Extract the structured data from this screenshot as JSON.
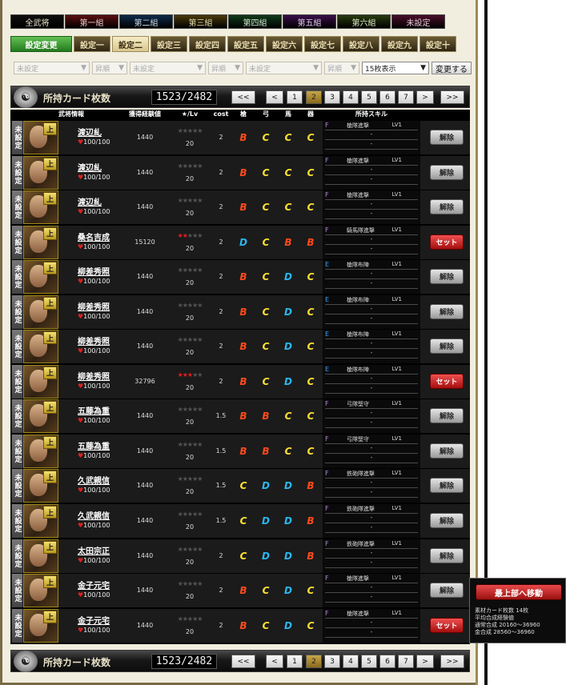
{
  "filter_tabs": [
    {
      "label": "全武将",
      "bg": "#0e0e0e",
      "fg": "#e8e2c8"
    },
    {
      "label": "第一組",
      "bg": "#5a1010",
      "fg": "#e8c8c8"
    },
    {
      "label": "第二組",
      "bg": "#0e2a4a",
      "fg": "#c8d8e8"
    },
    {
      "label": "第三組",
      "bg": "#4a3a0a",
      "fg": "#e8dcb0"
    },
    {
      "label": "第四組",
      "bg": "#0e3a1a",
      "fg": "#c8e8c8"
    },
    {
      "label": "第五組",
      "bg": "#3a0e4a",
      "fg": "#e0c8ec"
    },
    {
      "label": "第六組",
      "bg": "#2a3a10",
      "fg": "#d8e8c0"
    },
    {
      "label": "未設定",
      "bg": "#4a0e2a",
      "fg": "#e8c8d8"
    }
  ],
  "settings": {
    "change_label": "設定変更",
    "items": [
      "設定一",
      "設定二",
      "設定三",
      "設定四",
      "設定五",
      "設定六",
      "設定七",
      "設定八",
      "設定九",
      "設定十"
    ],
    "current": "設定二"
  },
  "filters": {
    "selects": [
      "未設定",
      "昇順",
      "未設定",
      "昇順",
      "未設定",
      "昇順"
    ],
    "per_page": "15枚表示",
    "change_button": "変更する"
  },
  "summary": {
    "label": "所持カード枚数",
    "count": "1523/2482"
  },
  "pager": [
    "<<",
    "<",
    "1",
    "2",
    "3",
    "4",
    "5",
    "6",
    "7",
    ">",
    ">>"
  ],
  "pager_current": "2",
  "headers": {
    "info": "武将情報",
    "exp": "獲得経験値",
    "star": "★/Lv",
    "cost": "cost",
    "a1": "槍",
    "a2": "弓",
    "a3": "馬",
    "a4": "器",
    "skill": "所持スキル"
  },
  "rows": [
    {
      "status": "未設定",
      "name": "渡辺糺",
      "hp": "100/100",
      "exp": "1440",
      "stars_red": "",
      "stars_grey": "★★★★★",
      "lv": "20",
      "cost": "2",
      "apt": [
        "B",
        "C",
        "C",
        "C"
      ],
      "rank": "F",
      "rank_color": "#b08ae0",
      "skill": "槍隊進撃",
      "skill_lv": "LV1",
      "action": "解除"
    },
    {
      "status": "未設定",
      "name": "渡辺糺",
      "hp": "100/100",
      "exp": "1440",
      "stars_red": "",
      "stars_grey": "★★★★★",
      "lv": "20",
      "cost": "2",
      "apt": [
        "B",
        "C",
        "C",
        "C"
      ],
      "rank": "F",
      "rank_color": "#b08ae0",
      "skill": "槍隊進撃",
      "skill_lv": "LV1",
      "action": "解除"
    },
    {
      "status": "未設定",
      "name": "渡辺糺",
      "hp": "100/100",
      "exp": "1440",
      "stars_red": "",
      "stars_grey": "★★★★★",
      "lv": "20",
      "cost": "2",
      "apt": [
        "B",
        "C",
        "C",
        "C"
      ],
      "rank": "F",
      "rank_color": "#b08ae0",
      "skill": "槍隊進撃",
      "skill_lv": "LV1",
      "action": "解除"
    },
    {
      "status": "未設定",
      "name": "桑名吉成",
      "hp": "100/100",
      "exp": "15120",
      "stars_red": "★★",
      "stars_grey": "★★★",
      "lv": "20",
      "cost": "2",
      "apt": [
        "D",
        "C",
        "B",
        "B"
      ],
      "rank": "F",
      "rank_color": "#b08ae0",
      "skill": "騎馬隊進撃",
      "skill_lv": "LV1",
      "action": "セット"
    },
    {
      "status": "未設定",
      "name": "柳差秀照",
      "hp": "100/100",
      "exp": "1440",
      "stars_red": "",
      "stars_grey": "★★★★★",
      "lv": "20",
      "cost": "2",
      "apt": [
        "B",
        "C",
        "D",
        "C"
      ],
      "rank": "E",
      "rank_color": "#3aa0ff",
      "skill": "槍隊布陣",
      "skill_lv": "LV1",
      "action": "解除"
    },
    {
      "status": "未設定",
      "name": "柳差秀照",
      "hp": "100/100",
      "exp": "1440",
      "stars_red": "",
      "stars_grey": "★★★★★",
      "lv": "20",
      "cost": "2",
      "apt": [
        "B",
        "C",
        "D",
        "C"
      ],
      "rank": "E",
      "rank_color": "#3aa0ff",
      "skill": "槍隊布陣",
      "skill_lv": "LV1",
      "action": "解除"
    },
    {
      "status": "未設定",
      "name": "柳差秀照",
      "hp": "100/100",
      "exp": "1440",
      "stars_red": "",
      "stars_grey": "★★★★★",
      "lv": "20",
      "cost": "2",
      "apt": [
        "B",
        "C",
        "D",
        "C"
      ],
      "rank": "E",
      "rank_color": "#3aa0ff",
      "skill": "槍隊布陣",
      "skill_lv": "LV1",
      "action": "解除"
    },
    {
      "status": "未設定",
      "name": "柳差秀照",
      "hp": "100/100",
      "exp": "32796",
      "stars_red": "★★★",
      "stars_grey": "★★",
      "lv": "20",
      "cost": "2",
      "apt": [
        "B",
        "C",
        "D",
        "C"
      ],
      "rank": "E",
      "rank_color": "#3aa0ff",
      "skill": "槍隊布陣",
      "skill_lv": "LV1",
      "action": "セット"
    },
    {
      "status": "未設定",
      "name": "五藤為重",
      "hp": "100/100",
      "exp": "1440",
      "stars_red": "",
      "stars_grey": "★★★★★",
      "lv": "20",
      "cost": "1.5",
      "apt": [
        "B",
        "B",
        "C",
        "C"
      ],
      "rank": "F",
      "rank_color": "#b08ae0",
      "skill": "弓隊堅守",
      "skill_lv": "LV1",
      "action": "解除"
    },
    {
      "status": "未設定",
      "name": "五藤為重",
      "hp": "100/100",
      "exp": "1440",
      "stars_red": "",
      "stars_grey": "★★★★★",
      "lv": "20",
      "cost": "1.5",
      "apt": [
        "B",
        "B",
        "C",
        "C"
      ],
      "rank": "F",
      "rank_color": "#b08ae0",
      "skill": "弓隊堅守",
      "skill_lv": "LV1",
      "action": "解除"
    },
    {
      "status": "未設定",
      "name": "久武親信",
      "hp": "100/100",
      "exp": "1440",
      "stars_red": "",
      "stars_grey": "★★★★★",
      "lv": "20",
      "cost": "1.5",
      "apt": [
        "C",
        "D",
        "D",
        "B"
      ],
      "rank": "F",
      "rank_color": "#b08ae0",
      "skill": "鉄砲隊進撃",
      "skill_lv": "LV1",
      "action": "解除"
    },
    {
      "status": "未設定",
      "name": "久武親信",
      "hp": "100/100",
      "exp": "1440",
      "stars_red": "",
      "stars_grey": "★★★★★",
      "lv": "20",
      "cost": "1.5",
      "apt": [
        "C",
        "D",
        "D",
        "B"
      ],
      "rank": "F",
      "rank_color": "#b08ae0",
      "skill": "鉄砲隊進撃",
      "skill_lv": "LV1",
      "action": "解除"
    },
    {
      "status": "未設定",
      "name": "太田宗正",
      "hp": "100/100",
      "exp": "1440",
      "stars_red": "",
      "stars_grey": "★★★★★",
      "lv": "20",
      "cost": "2",
      "apt": [
        "C",
        "D",
        "D",
        "B"
      ],
      "rank": "F",
      "rank_color": "#b08ae0",
      "skill": "鉄砲隊進撃",
      "skill_lv": "LV1",
      "action": "解除"
    },
    {
      "status": "未設定",
      "name": "金子元宅",
      "hp": "100/100",
      "exp": "1440",
      "stars_red": "",
      "stars_grey": "★★★★★",
      "lv": "20",
      "cost": "2",
      "apt": [
        "B",
        "C",
        "D",
        "C"
      ],
      "rank": "F",
      "rank_color": "#b08ae0",
      "skill": "槍隊進撃",
      "skill_lv": "LV1",
      "action": "解除"
    },
    {
      "status": "未設定",
      "name": "金子元宅",
      "hp": "100/100",
      "exp": "1440",
      "stars_red": "",
      "stars_grey": "★★★★★",
      "lv": "20",
      "cost": "2",
      "apt": [
        "B",
        "C",
        "D",
        "C"
      ],
      "rank": "F",
      "rank_color": "#b08ae0",
      "skill": "槍隊進撃",
      "skill_lv": "LV1",
      "action": "セット"
    }
  ],
  "popup": {
    "top_button": "最上部へ移動",
    "lines": [
      "素材カード枚数 14枚",
      "平均合成経験値",
      "通常合成 20160～36960",
      "金合成 28560～36960"
    ]
  }
}
